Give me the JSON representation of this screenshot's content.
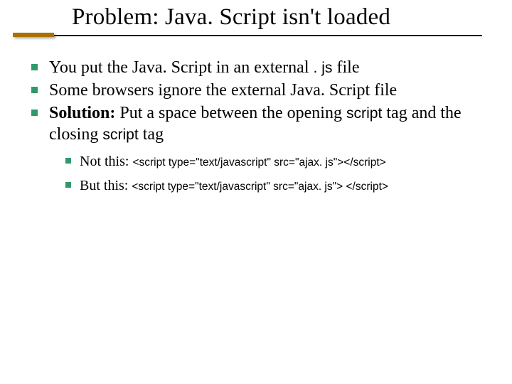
{
  "title": "Problem: Java. Script isn't loaded",
  "bullets": {
    "b1_pre": "You put the Java. Script in an external ",
    "b1_code": ". js",
    "b1_post": " file",
    "b2": "Some browsers ignore the external Java. Script file",
    "b3_bold": "Solution:",
    "b3_mid": " Put a space between the opening ",
    "b3_code1": "script",
    "b3_mid2": " tag and the closing ",
    "b3_code2": "script",
    "b3_end": " tag"
  },
  "sub": {
    "s1_label": "Not this: ",
    "s1_code": "<script type=\"text/javascript\" src=\"ajax. js\"></script>",
    "s2_label": "But this: ",
    "s2_code": "<script type=\"text/javascript\" src=\"ajax. js\"> </script>"
  }
}
